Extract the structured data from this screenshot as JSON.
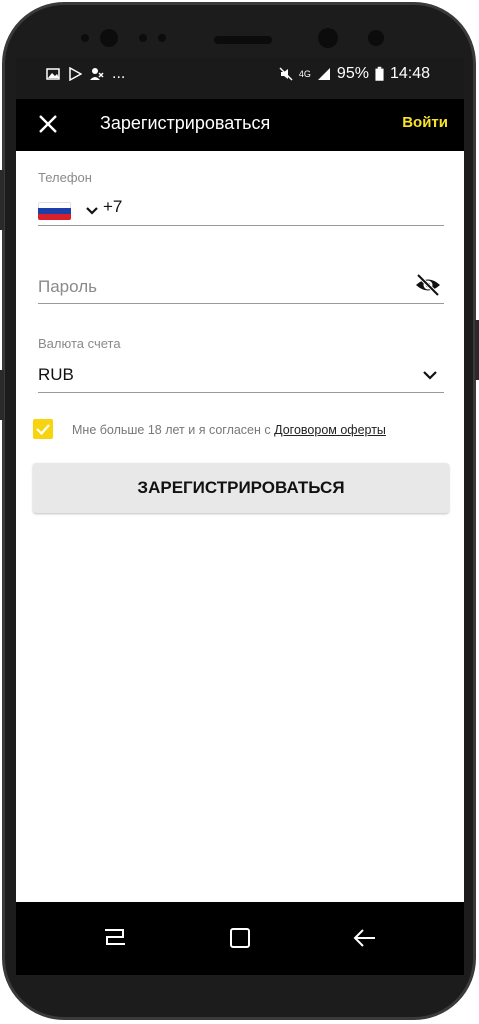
{
  "statusbar": {
    "notification_icons": [
      "image-icon",
      "play-store-icon",
      "missed-call-icon"
    ],
    "more": "...",
    "network": "4G",
    "battery": "95%",
    "time": "14:48"
  },
  "appbar": {
    "title": "Зарегистрироваться",
    "login_label": "Войти"
  },
  "form": {
    "phone_label": "Телефон",
    "phone_code": "+7",
    "country_flag": "russia-flag-icon",
    "password_placeholder": "Пароль",
    "currency_label": "Валюта счета",
    "currency_value": "RUB",
    "agree_text": "Мне больше 18 лет и я согласен с",
    "agree_link": "Договором оферты",
    "agree_checked": true,
    "register_label": "ЗАРЕГИСТРИРОВАТЬСЯ"
  },
  "colors": {
    "accent": "#f8e32a",
    "checkbox": "#f8d40f",
    "appbar": "#000000",
    "button": "#e8e8e8"
  },
  "navbar": {
    "icons": [
      "recent-apps-icon",
      "home-icon",
      "back-icon"
    ]
  }
}
